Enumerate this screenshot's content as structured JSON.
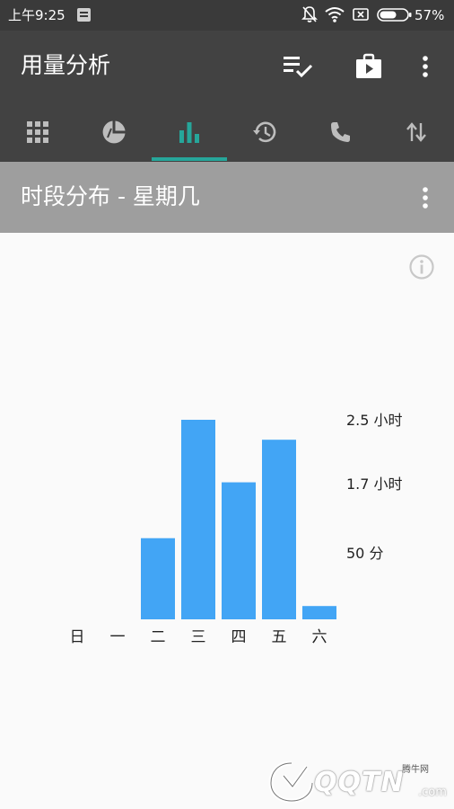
{
  "status_bar": {
    "time": "上午9:25",
    "battery_percent": "57%",
    "icons": [
      "notification-app-icon",
      "mute-icon",
      "wifi-icon",
      "sim-off-icon",
      "battery-icon"
    ]
  },
  "app_bar": {
    "title": "用量分析",
    "actions": [
      "checklist-icon",
      "app-store-icon",
      "more-vert-icon"
    ]
  },
  "tabs": {
    "items": [
      {
        "icon": "apps-grid-icon",
        "selected": false
      },
      {
        "icon": "pie-chart-icon",
        "selected": false
      },
      {
        "icon": "bar-chart-icon",
        "selected": true
      },
      {
        "icon": "history-icon",
        "selected": false
      },
      {
        "icon": "phone-icon",
        "selected": false
      },
      {
        "icon": "data-transfer-icon",
        "selected": false
      }
    ],
    "indicator_color": "#26a69a"
  },
  "section": {
    "title": "时段分布 - 星期几",
    "menu_icon": "more-vert-icon"
  },
  "info_icon": "info-icon",
  "chart_data": {
    "type": "bar",
    "categories": [
      "日",
      "一",
      "二",
      "三",
      "四",
      "五",
      "六"
    ],
    "values_minutes": [
      0,
      0,
      61,
      150,
      103,
      135,
      10
    ],
    "reference_labels": [
      {
        "text": "2.5 小时",
        "minutes": 150
      },
      {
        "text": "1.7 小时",
        "minutes": 102
      },
      {
        "text": "50 分",
        "minutes": 50
      }
    ],
    "bar_color": "#42a5f5",
    "ylim_minutes": [
      0,
      150
    ]
  },
  "watermark": {
    "text": "QQTN",
    "small": "腾牛网",
    "suffix": ".com"
  },
  "colors": {
    "status_bar": "#3a3a3a",
    "app_bar": "#424242",
    "section_header": "#9e9e9e"
  }
}
